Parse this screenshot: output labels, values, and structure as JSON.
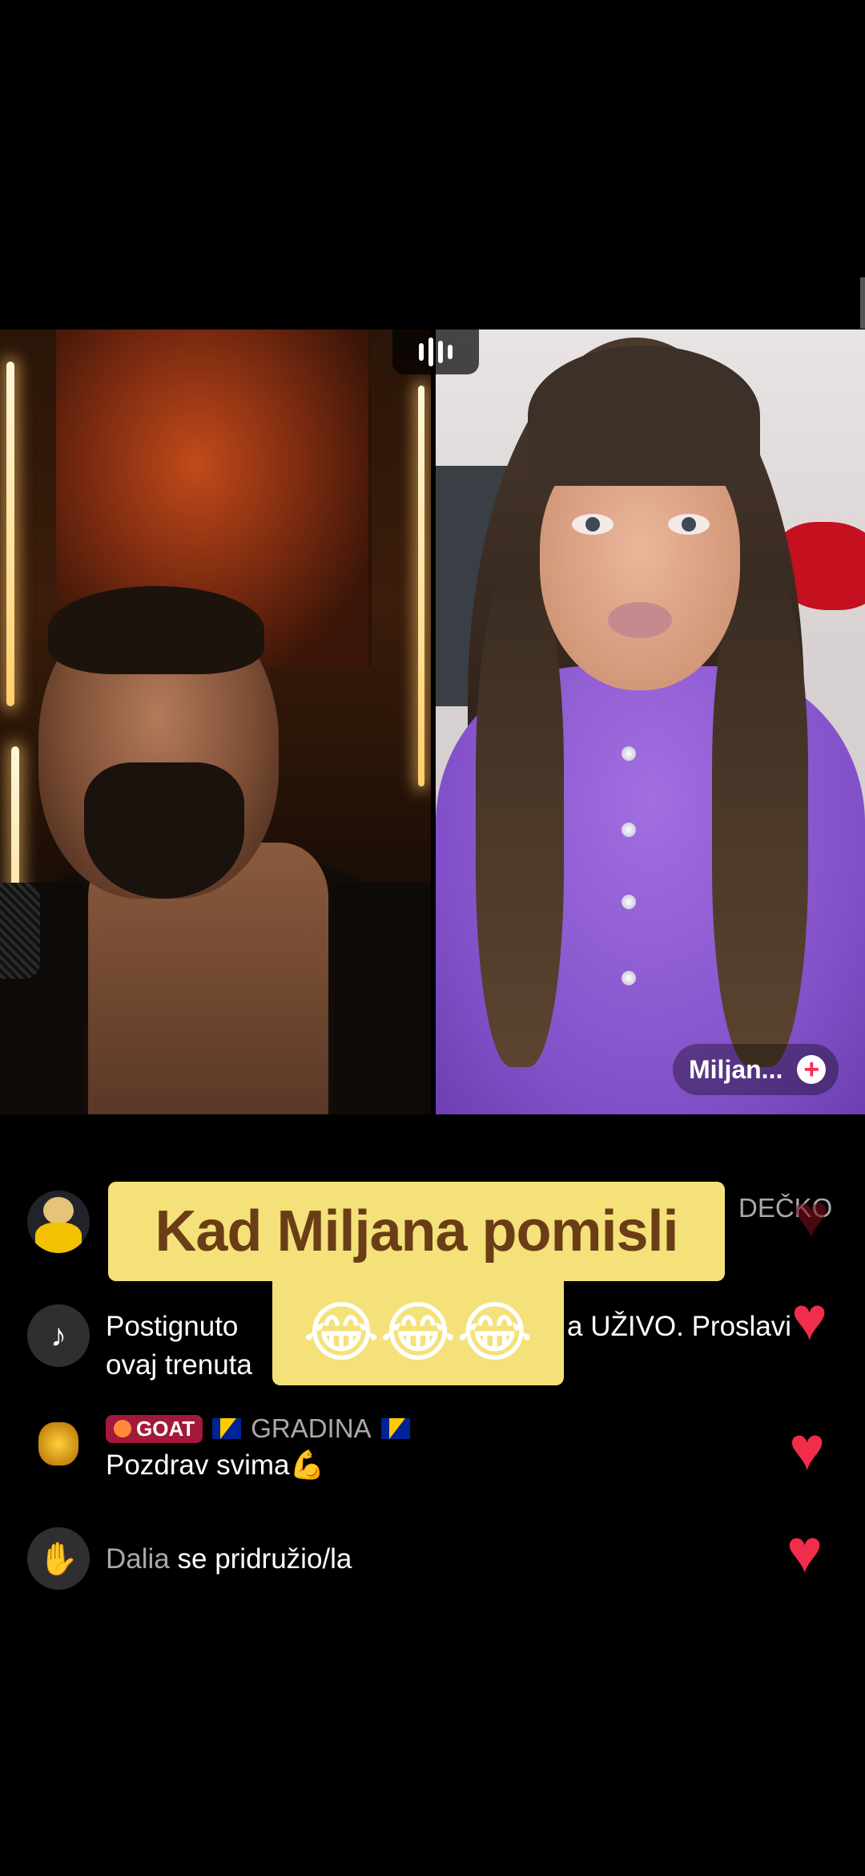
{
  "live": {
    "guest_name": "Miljan...",
    "plus_glyph": "+"
  },
  "caption": {
    "line1": "Kad Miljana pomisli",
    "line2": "😂😂😂"
  },
  "comments": [
    {
      "username": "DEČKO",
      "text": ""
    },
    {
      "text_line1": "Postignuto",
      "text_line1_end": "a UŽIVO. Proslavi",
      "text_line2": "ovaj trenuta",
      "avatar_icon": "tiktok-icon"
    },
    {
      "badge": "GOAT",
      "username": "GRADINA",
      "text": "Pozdrav svima💪",
      "avatar_icon": "gold-character-avatar"
    },
    {
      "username": "Dalia",
      "text": "se pridružio/la",
      "avatar_icon": "wave-hand-icon"
    }
  ],
  "colors": {
    "background": "#000000",
    "heart": "#f02d4a",
    "caption_bg": "#f4e17a",
    "caption_text": "#6b3d16",
    "badge": "#a3193a"
  }
}
